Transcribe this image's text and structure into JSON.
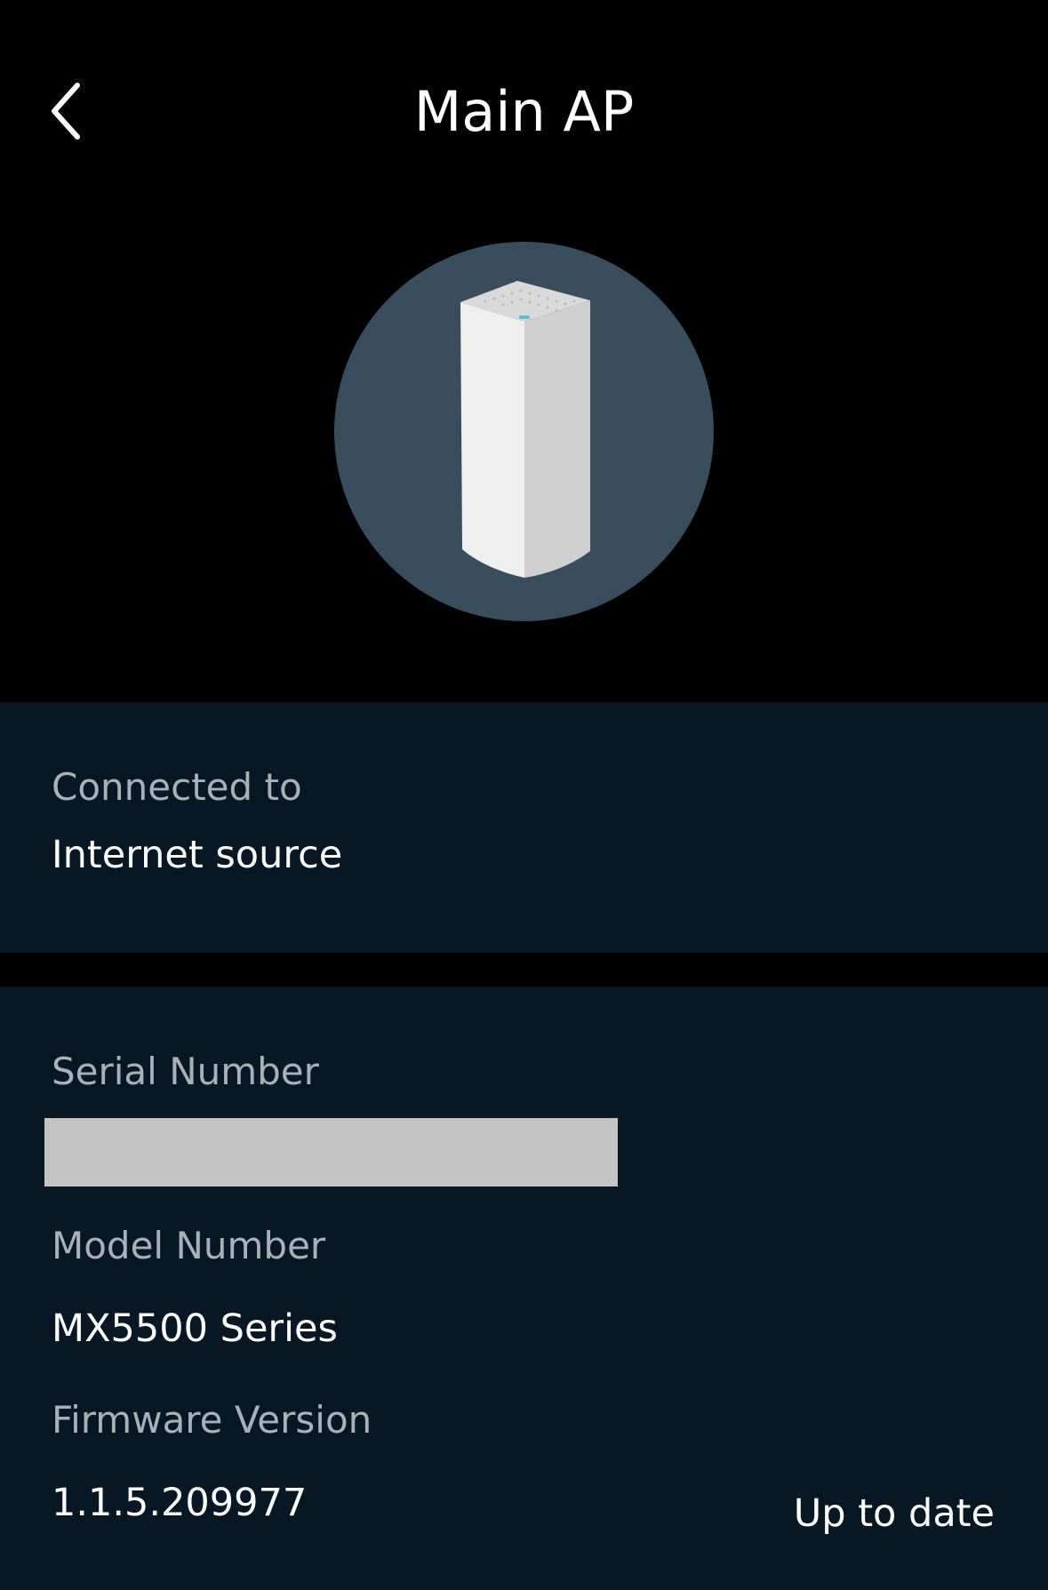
{
  "header": {
    "title": "Main AP",
    "back_icon": "chevron-left-icon"
  },
  "device": {
    "image_icon": "mesh-router-node-icon",
    "circle_color": "#384d5d"
  },
  "connection": {
    "label": "Connected to",
    "value": "Internet source"
  },
  "details": {
    "serial_label": "Serial Number",
    "model_label": "Model Number",
    "model_value": "MX5500 Series",
    "firmware_label": "Firmware Version",
    "firmware_value": "1.1.5.209977",
    "firmware_status": "Up to date"
  },
  "colors": {
    "background": "#000000",
    "card": "#071824",
    "label": "#a7b1b8",
    "redaction": "#c4c4c4"
  }
}
